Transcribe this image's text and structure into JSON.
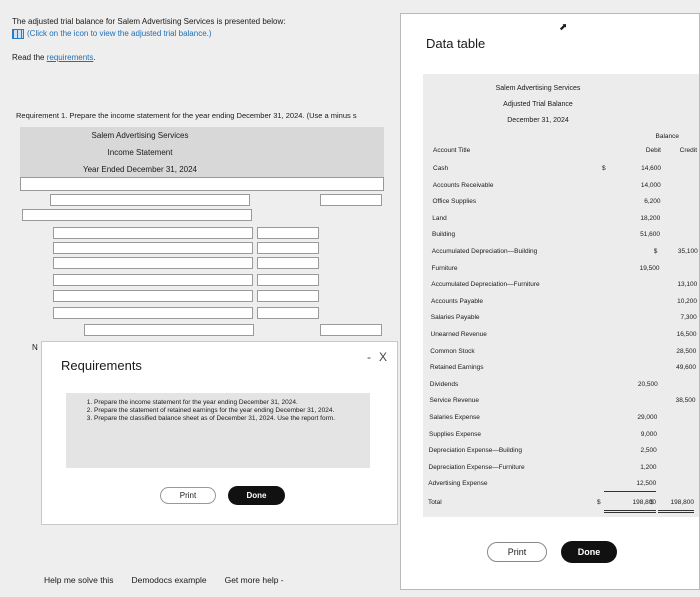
{
  "intro": {
    "line1": "The adjusted trial balance for Salem Advertising Services is presented below:",
    "line2": "(Click on the icon to view the adjusted trial balance.)",
    "read_prefix": "Read the ",
    "read_link": "requirements",
    "read_suffix": "."
  },
  "requirement1": "Requirement 1. Prepare the income statement for the year ending December 31, 2024. (Use a minus s",
  "statement": {
    "company": "Salem Advertising Services",
    "title": "Income Statement",
    "period": "Year Ended December 31, 2024"
  },
  "n_letter": "N",
  "requirements_panel": {
    "title": "Requirements",
    "minimize": "-",
    "close": "X",
    "items": [
      "Prepare the income statement for the year ending December 31, 2024.",
      "Prepare the statement of retained earnings for the year ending December 31, 2024.",
      "Prepare the classified balance sheet as of December 31, 2024. Use the report form."
    ],
    "print_label": "Print",
    "done_label": "Done"
  },
  "bottom_bar": {
    "help": "Help me solve this",
    "demodocs": "Demodocs example",
    "more_help": "Get more help -"
  },
  "data_table": {
    "title": "Data table",
    "company": "Salem Advertising Services",
    "report": "Adjusted Trial Balance",
    "date": "December 31, 2024",
    "balance_header": "Balance",
    "col_title": "Account Title",
    "col_debit": "Debit",
    "col_credit": "Credit",
    "rows": [
      {
        "title": "Cash",
        "dsign": "$",
        "debit": "14,600",
        "csign": "",
        "credit": ""
      },
      {
        "title": "Accounts Receivable",
        "dsign": "",
        "debit": "14,000",
        "csign": "",
        "credit": ""
      },
      {
        "title": "Office Supplies",
        "dsign": "",
        "debit": "6,200",
        "csign": "",
        "credit": ""
      },
      {
        "title": "Land",
        "dsign": "",
        "debit": "18,200",
        "csign": "",
        "credit": ""
      },
      {
        "title": "Building",
        "dsign": "",
        "debit": "51,600",
        "csign": "",
        "credit": ""
      },
      {
        "title": "Accumulated Depreciation—Building",
        "dsign": "",
        "debit": "",
        "csign": "$",
        "credit": "35,100"
      },
      {
        "title": "Furniture",
        "dsign": "",
        "debit": "19,500",
        "csign": "",
        "credit": ""
      },
      {
        "title": "Accumulated Depreciation—Furniture",
        "dsign": "",
        "debit": "",
        "csign": "",
        "credit": "13,100"
      },
      {
        "title": "Accounts Payable",
        "dsign": "",
        "debit": "",
        "csign": "",
        "credit": "10,200"
      },
      {
        "title": "Salaries Payable",
        "dsign": "",
        "debit": "",
        "csign": "",
        "credit": "7,300"
      },
      {
        "title": "Unearned Revenue",
        "dsign": "",
        "debit": "",
        "csign": "",
        "credit": "16,500"
      },
      {
        "title": "Common Stock",
        "dsign": "",
        "debit": "",
        "csign": "",
        "credit": "28,500"
      },
      {
        "title": "Retained Earnings",
        "dsign": "",
        "debit": "",
        "csign": "",
        "credit": "49,600"
      },
      {
        "title": "Dividends",
        "dsign": "",
        "debit": "20,500",
        "csign": "",
        "credit": ""
      },
      {
        "title": "Service Revenue",
        "dsign": "",
        "debit": "",
        "csign": "",
        "credit": "38,500"
      },
      {
        "title": "Salaries Expense",
        "dsign": "",
        "debit": "29,000",
        "csign": "",
        "credit": ""
      },
      {
        "title": "Supplies Expense",
        "dsign": "",
        "debit": "9,000",
        "csign": "",
        "credit": ""
      },
      {
        "title": "Depreciation Expense—Building",
        "dsign": "",
        "debit": "2,500",
        "csign": "",
        "credit": ""
      },
      {
        "title": "Depreciation Expense—Furniture",
        "dsign": "",
        "debit": "1,200",
        "csign": "",
        "credit": ""
      },
      {
        "title": "Advertising Expense",
        "dsign": "",
        "debit": "12,500",
        "csign": "",
        "credit": ""
      }
    ],
    "total": {
      "title": "Total",
      "dsign": "$",
      "debit": "198,800",
      "csign": "$",
      "credit": "198,800"
    },
    "print_label": "Print",
    "done_label": "Done"
  }
}
